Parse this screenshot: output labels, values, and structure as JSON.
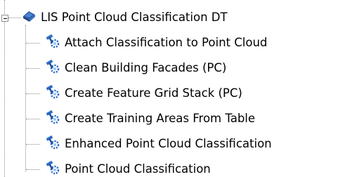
{
  "tree": {
    "root": {
      "label": "LIS Point Cloud Classification DT",
      "icon": "toolbox-icon",
      "expanded": true
    },
    "items": [
      {
        "label": "Attach Classification to Point Cloud",
        "icon": "tool-hammer-icon"
      },
      {
        "label": "Clean Building Facades (PC)",
        "icon": "tool-hammer-icon"
      },
      {
        "label": "Create Feature Grid Stack (PC)",
        "icon": "tool-hammer-icon"
      },
      {
        "label": "Create Training Areas From Table",
        "icon": "tool-hammer-icon"
      },
      {
        "label": "Enhanced Point Cloud Classification",
        "icon": "tool-hammer-icon"
      },
      {
        "label": "Point Cloud Classification",
        "icon": "tool-hammer-icon"
      }
    ]
  },
  "colors": {
    "toolbox_blue": "#2b5ea8",
    "tool_blue": "#2f6fc9",
    "tool_light": "#9cc4f0",
    "connector": "#8c8c8c"
  }
}
